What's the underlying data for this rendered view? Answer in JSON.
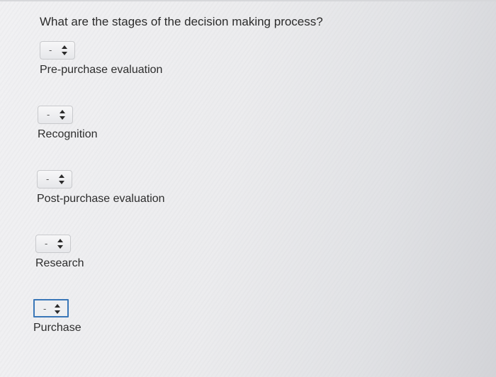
{
  "question": "What are the stages of the decision making process?",
  "items": [
    {
      "select_value": "-",
      "label": "Pre-purchase evaluation"
    },
    {
      "select_value": "-",
      "label": "Recognition"
    },
    {
      "select_value": "-",
      "label": "Post-purchase evaluation"
    },
    {
      "select_value": "-",
      "label": "Research"
    },
    {
      "select_value": "-",
      "label": "Purchase"
    }
  ],
  "icons": {
    "select_arrows": "up-down-arrows-icon"
  },
  "colors": {
    "focus_border": "#3a77b8"
  }
}
